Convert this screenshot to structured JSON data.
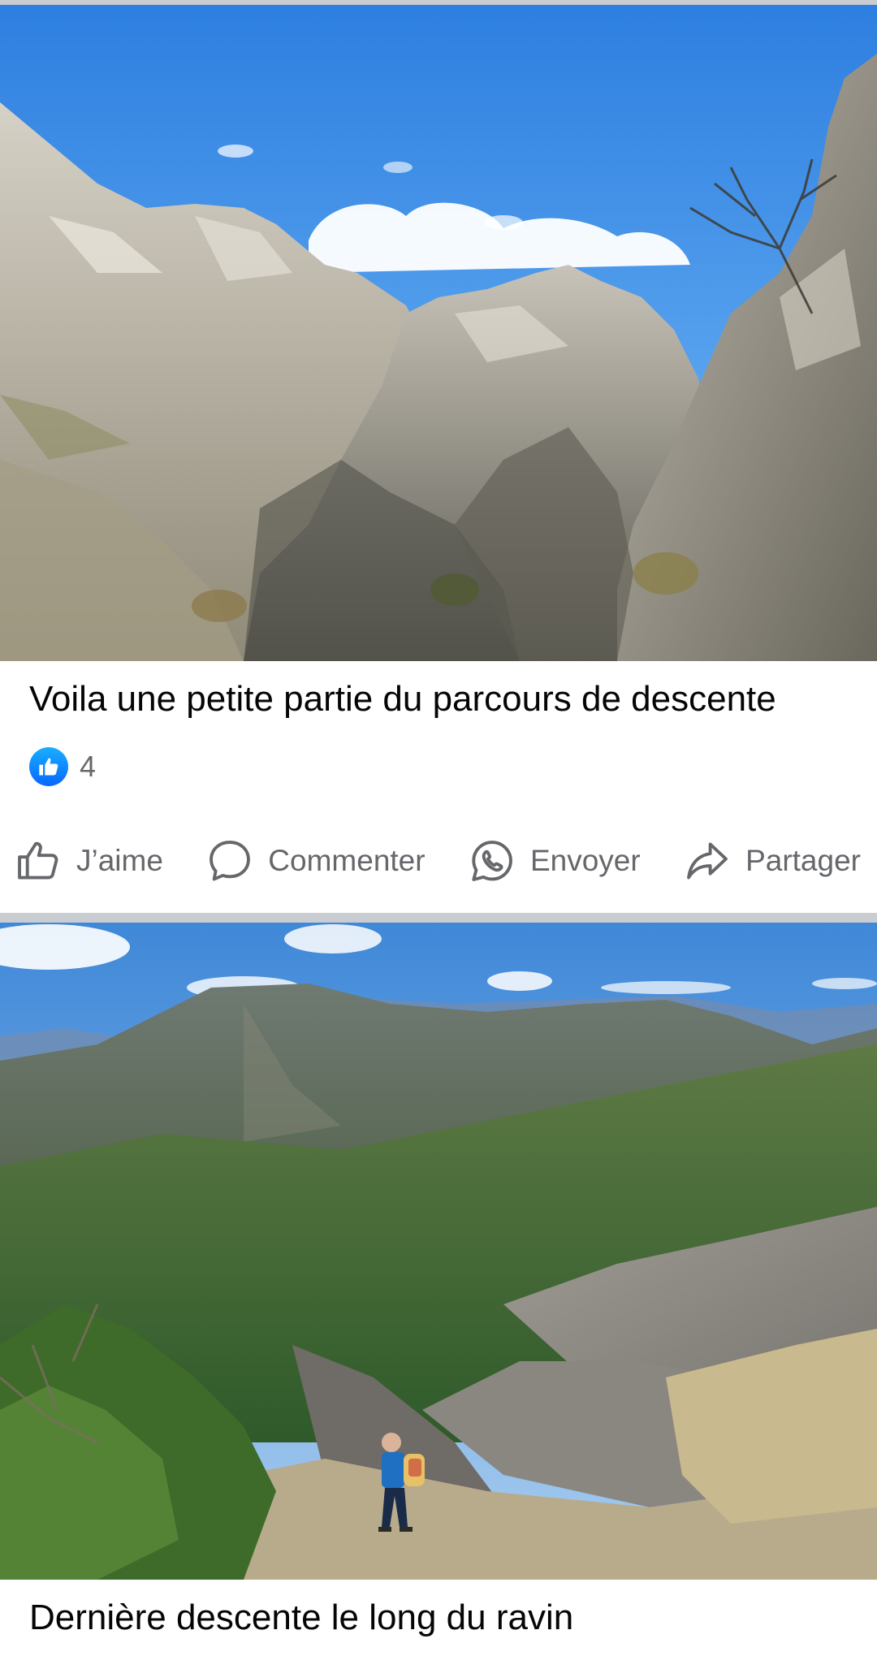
{
  "posts": [
    {
      "caption": "Voila une petite partie du parcours de descente",
      "reactions": {
        "icon": "thumbs-up-badge-icon",
        "count": "4",
        "color": "#0866ff"
      }
    },
    {
      "caption": "Dernière descente le long du ravin"
    }
  ],
  "actions": [
    {
      "label": "J’aime",
      "icon": "thumbs-up-icon"
    },
    {
      "label": "Commenter",
      "icon": "comment-bubble-icon"
    },
    {
      "label": "Envoyer",
      "icon": "whatsapp-icon"
    },
    {
      "label": "Partager",
      "icon": "share-arrow-icon"
    }
  ],
  "colors": {
    "text": "#050505",
    "secondary_text": "#65676b",
    "like_blue": "#0866ff",
    "separator": "#c9ccd1"
  }
}
